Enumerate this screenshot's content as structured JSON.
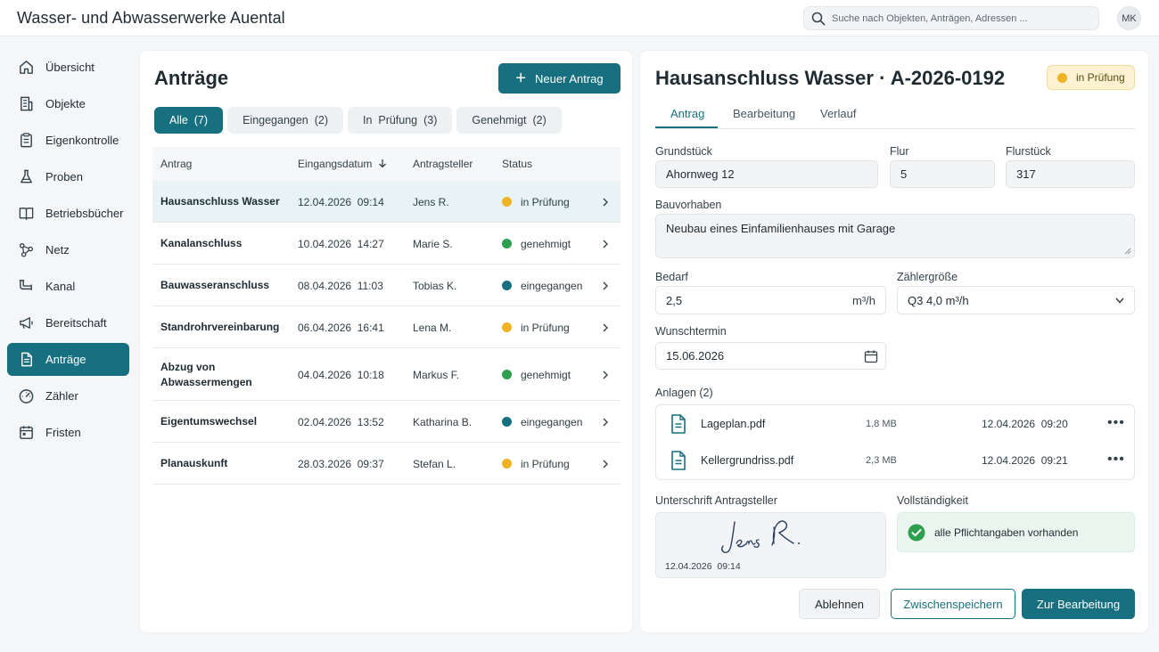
{
  "app": {
    "title": "Wasser- und Abwasserwerke Auental",
    "search_placeholder": "Suche nach Objekten, Anträgen, Adressen ...",
    "user_initials": "MK"
  },
  "colors": {
    "accent": "#17707f",
    "status_review": "#f0b323",
    "status_approved": "#2e9e4f",
    "status_received": "#17707f"
  },
  "sidebar": {
    "items": [
      {
        "label": "Übersicht",
        "icon": "home-icon"
      },
      {
        "label": "Objekte",
        "icon": "building-icon"
      },
      {
        "label": "Eigenkontrolle",
        "icon": "clipboard-icon"
      },
      {
        "label": "Proben",
        "icon": "flask-icon"
      },
      {
        "label": "Betriebsbücher",
        "icon": "book-icon"
      },
      {
        "label": "Netz",
        "icon": "network-icon"
      },
      {
        "label": "Kanal",
        "icon": "pipe-icon"
      },
      {
        "label": "Bereitschaft",
        "icon": "megaphone-icon"
      },
      {
        "label": "Anträge",
        "icon": "document-icon",
        "active": true
      },
      {
        "label": "Zähler",
        "icon": "gauge-icon"
      },
      {
        "label": "Fristen",
        "icon": "calendar-icon"
      }
    ]
  },
  "list": {
    "title": "Anträge",
    "new_button": "Neuer Antrag",
    "filters": [
      {
        "label": "Alle  (7)",
        "active": true
      },
      {
        "label": "Eingegangen  (2)"
      },
      {
        "label": "In  Prüfung  (3)"
      },
      {
        "label": "Genehmigt  (2)"
      }
    ],
    "columns": {
      "name": "Antrag",
      "date": "Eingangsdatum",
      "applicant": "Antragsteller",
      "status": "Status"
    },
    "rows": [
      {
        "name": "Hausanschluss Wasser",
        "date": "12.04.2026  09:14",
        "applicant": "Jens R.",
        "status": "in Prüfung",
        "status_key": "review",
        "selected": true
      },
      {
        "name": "Kanalanschluss",
        "date": "10.04.2026  14:27",
        "applicant": "Marie S.",
        "status": "genehmigt",
        "status_key": "approved"
      },
      {
        "name": "Bauwasseranschluss",
        "date": "08.04.2026  11:03",
        "applicant": "Tobias K.",
        "status": "eingegangen",
        "status_key": "received"
      },
      {
        "name": "Standrohrvereinbarung",
        "date": "06.04.2026  16:41",
        "applicant": "Lena M.",
        "status": "in Prüfung",
        "status_key": "review"
      },
      {
        "name": "Abzug von Abwassermengen",
        "date": "04.04.2026  10:18",
        "applicant": "Markus F.",
        "status": "genehmigt",
        "status_key": "approved"
      },
      {
        "name": "Eigentumswechsel",
        "date": "02.04.2026  13:52",
        "applicant": "Katharina B.",
        "status": "eingegangen",
        "status_key": "received"
      },
      {
        "name": "Planauskunft",
        "date": "28.03.2026  09:37",
        "applicant": "Stefan L.",
        "status": "in Prüfung",
        "status_key": "review"
      }
    ]
  },
  "detail": {
    "title": "Hausanschluss Wasser · A-2026-0192",
    "status": "in Prüfung",
    "tabs": [
      "Antrag",
      "Bearbeitung",
      "Verlauf"
    ],
    "labels": {
      "grundstueck": "Grundstück",
      "flur": "Flur",
      "flurstueck": "Flurstück",
      "bauvorhaben": "Bauvorhaben",
      "bedarf": "Bedarf",
      "zaehlergroesse": "Zählergröße",
      "wunschtermin": "Wunschtermin",
      "anlagen": "Anlagen (2)",
      "unterschrift": "Unterschrift Antragsteller",
      "vollstaendigkeit": "Vollständigkeit"
    },
    "values": {
      "grundstueck": "Ahornweg 12",
      "flur": "5",
      "flurstueck": "317",
      "bauvorhaben": "Neubau eines Einfamilienhauses mit Garage",
      "bedarf": "2,5",
      "bedarf_unit": "m³/h",
      "zaehlergroesse": "Q3 4,0 m³/h",
      "wunschtermin": "15.06.2026"
    },
    "attachments": [
      {
        "name": "Lageplan.pdf",
        "size": "1,8 MB",
        "date": "12.04.2026  09:20"
      },
      {
        "name": "Kellergrundriss.pdf",
        "size": "2,3 MB",
        "date": "12.04.2026  09:21"
      }
    ],
    "signature": {
      "name": "Jens R.",
      "date": "12.04.2026  09:14"
    },
    "completeness": "alle Pflichtangaben vorhanden",
    "buttons": {
      "reject": "Ablehnen",
      "save": "Zwischenspeichern",
      "proceed": "Zur Bearbeitung"
    }
  }
}
